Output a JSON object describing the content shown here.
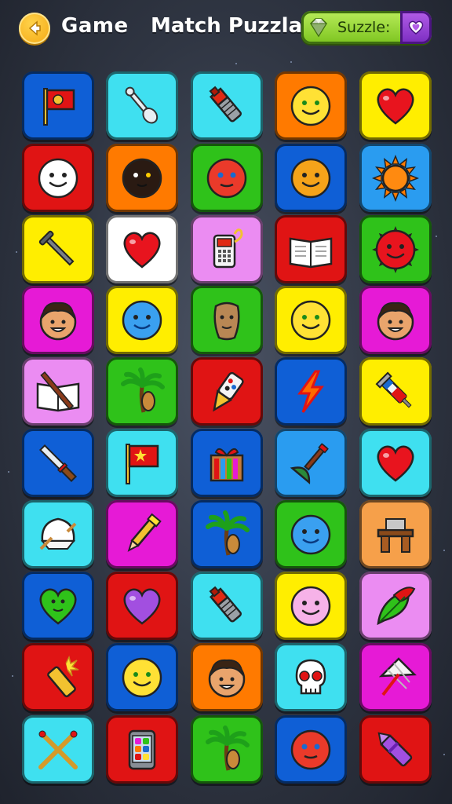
{
  "header": {
    "back_icon": "back-arrow-icon",
    "title_left": "Game",
    "title_main": "Match Puzzla",
    "score_label": "Suzzle:",
    "score_icon": "gem-icon",
    "heart_icon": "heart-icon"
  },
  "colors": {
    "blue": "#0f5fd6",
    "cyan": "#3fe0f0",
    "orange": "#ff7a00",
    "yellow": "#ffee00",
    "red": "#e01414",
    "green": "#2fc21a",
    "magenta": "#e61ad6",
    "pink": "#eb8cf2",
    "white": "#ffffff",
    "lightblue": "#2a9cf0",
    "peach": "#f6a04a"
  },
  "board": {
    "rows": [
      [
        {
          "bg": "blue",
          "icon": "red-flag-icon"
        },
        {
          "bg": "cyan",
          "icon": "spoon-tool-icon"
        },
        {
          "bg": "cyan",
          "icon": "paint-tube-icon"
        },
        {
          "bg": "orange",
          "icon": "yellow-face-icon"
        },
        {
          "bg": "yellow",
          "icon": "red-heart-icon"
        }
      ],
      [
        {
          "bg": "red",
          "icon": "white-face-icon"
        },
        {
          "bg": "orange",
          "icon": "dark-face-icon"
        },
        {
          "bg": "green",
          "icon": "red-face-icon"
        },
        {
          "bg": "blue",
          "icon": "orange-face-icon"
        },
        {
          "bg": "lightblue",
          "icon": "sun-icon"
        }
      ],
      [
        {
          "bg": "yellow",
          "icon": "nail-icon"
        },
        {
          "bg": "white",
          "icon": "red-heart-icon"
        },
        {
          "bg": "pink",
          "icon": "handheld-device-icon"
        },
        {
          "bg": "red",
          "icon": "open-book-icon"
        },
        {
          "bg": "green",
          "icon": "red-sun-icon"
        }
      ],
      [
        {
          "bg": "magenta",
          "icon": "boy-face-icon"
        },
        {
          "bg": "yellow",
          "icon": "blue-face-icon"
        },
        {
          "bg": "green",
          "icon": "potato-face-icon"
        },
        {
          "bg": "yellow",
          "icon": "yellow-face-icon"
        },
        {
          "bg": "magenta",
          "icon": "boy-face-icon"
        }
      ],
      [
        {
          "bg": "pink",
          "icon": "book-pencil-icon"
        },
        {
          "bg": "green",
          "icon": "palm-tree-icon"
        },
        {
          "bg": "red",
          "icon": "paint-brush-icon"
        },
        {
          "bg": "blue",
          "icon": "lightning-icon"
        },
        {
          "bg": "yellow",
          "icon": "syringe-icon"
        }
      ],
      [
        {
          "bg": "blue",
          "icon": "knife-icon"
        },
        {
          "bg": "cyan",
          "icon": "star-flag-icon"
        },
        {
          "bg": "blue",
          "icon": "gift-box-icon"
        },
        {
          "bg": "lightblue",
          "icon": "plunger-icon"
        },
        {
          "bg": "cyan",
          "icon": "red-heart-icon"
        }
      ],
      [
        {
          "bg": "cyan",
          "icon": "rice-ball-icon"
        },
        {
          "bg": "magenta",
          "icon": "pencil-icon"
        },
        {
          "bg": "blue",
          "icon": "palm-tree-icon"
        },
        {
          "bg": "green",
          "icon": "blue-face-icon"
        },
        {
          "bg": "peach",
          "icon": "desk-icon"
        }
      ],
      [
        {
          "bg": "blue",
          "icon": "green-heart-face-icon"
        },
        {
          "bg": "red",
          "icon": "purple-heart-icon"
        },
        {
          "bg": "cyan",
          "icon": "paint-tube-icon"
        },
        {
          "bg": "yellow",
          "icon": "pink-face-icon"
        },
        {
          "bg": "pink",
          "icon": "leaf-icon"
        }
      ],
      [
        {
          "bg": "red",
          "icon": "firecracker-icon"
        },
        {
          "bg": "blue",
          "icon": "yellow-face-icon"
        },
        {
          "bg": "orange",
          "icon": "boy-face-icon"
        },
        {
          "bg": "cyan",
          "icon": "skull-icon"
        },
        {
          "bg": "magenta",
          "icon": "umbrella-icon"
        }
      ],
      [
        {
          "bg": "cyan",
          "icon": "crossed-sticks-icon"
        },
        {
          "bg": "red",
          "icon": "phone-icon"
        },
        {
          "bg": "green",
          "icon": "palm-tree-icon"
        },
        {
          "bg": "blue",
          "icon": "red-face-icon"
        },
        {
          "bg": "red",
          "icon": "crayon-icon"
        }
      ]
    ]
  }
}
